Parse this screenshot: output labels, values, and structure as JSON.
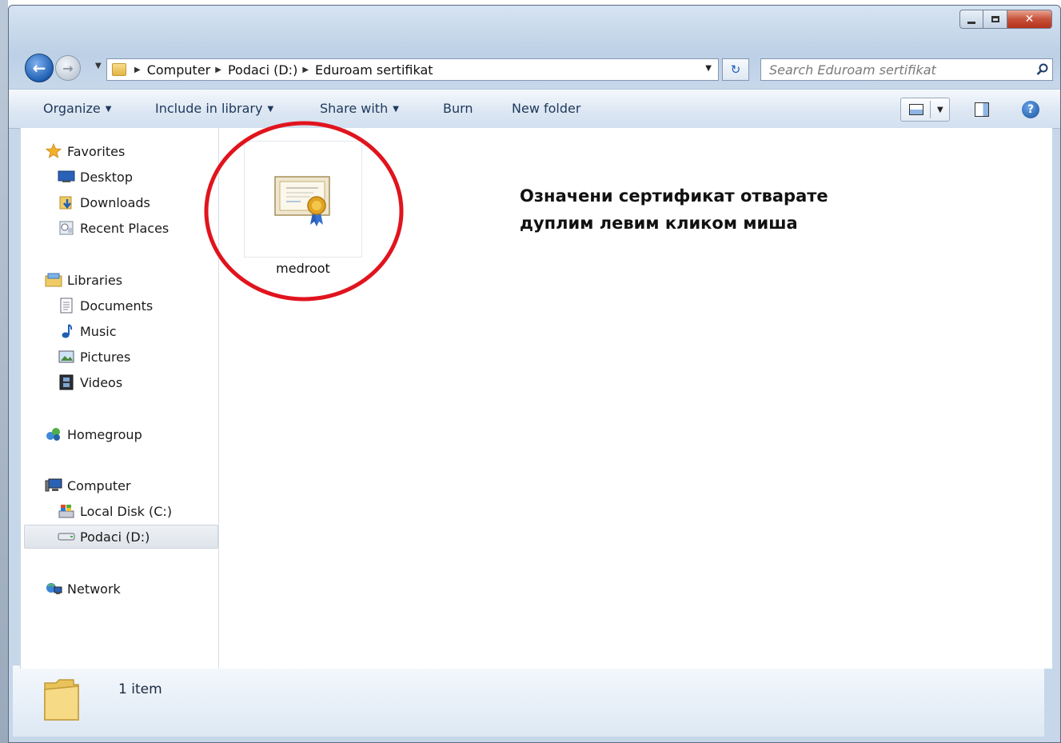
{
  "window": {
    "caption": {
      "minimize": "minimize",
      "maximize": "maximize",
      "close": "close"
    }
  },
  "navigation": {
    "breadcrumb": [
      "Computer",
      "Podaci (D:)",
      "Eduroam sertifikat"
    ],
    "search_placeholder": "Search Eduroam sertifikat"
  },
  "toolbar": {
    "organize": "Organize",
    "include_in_library": "Include in library",
    "share_with": "Share with",
    "burn": "Burn",
    "new_folder": "New folder"
  },
  "sidebar": {
    "favorites": {
      "label": "Favorites",
      "items": [
        "Desktop",
        "Downloads",
        "Recent Places"
      ]
    },
    "libraries": {
      "label": "Libraries",
      "items": [
        "Documents",
        "Music",
        "Pictures",
        "Videos"
      ]
    },
    "homegroup": "Homegroup",
    "computer": {
      "label": "Computer",
      "items": [
        "Local Disk (C:)",
        "Podaci (D:)"
      ]
    },
    "network": "Network",
    "selected": "Podaci (D:)"
  },
  "files": [
    {
      "name": "medroot",
      "icon": "certificate-icon"
    }
  ],
  "annotation": {
    "line1": "Означени сертификат отварате",
    "line2": "дуплим левим кликом миша",
    "highlight_color": "#e0141e"
  },
  "status": {
    "item_count": "1 item"
  },
  "colors": {
    "accent": "#1f5fb3",
    "highlight": "#e0141e",
    "close_button": "#c7513a"
  }
}
